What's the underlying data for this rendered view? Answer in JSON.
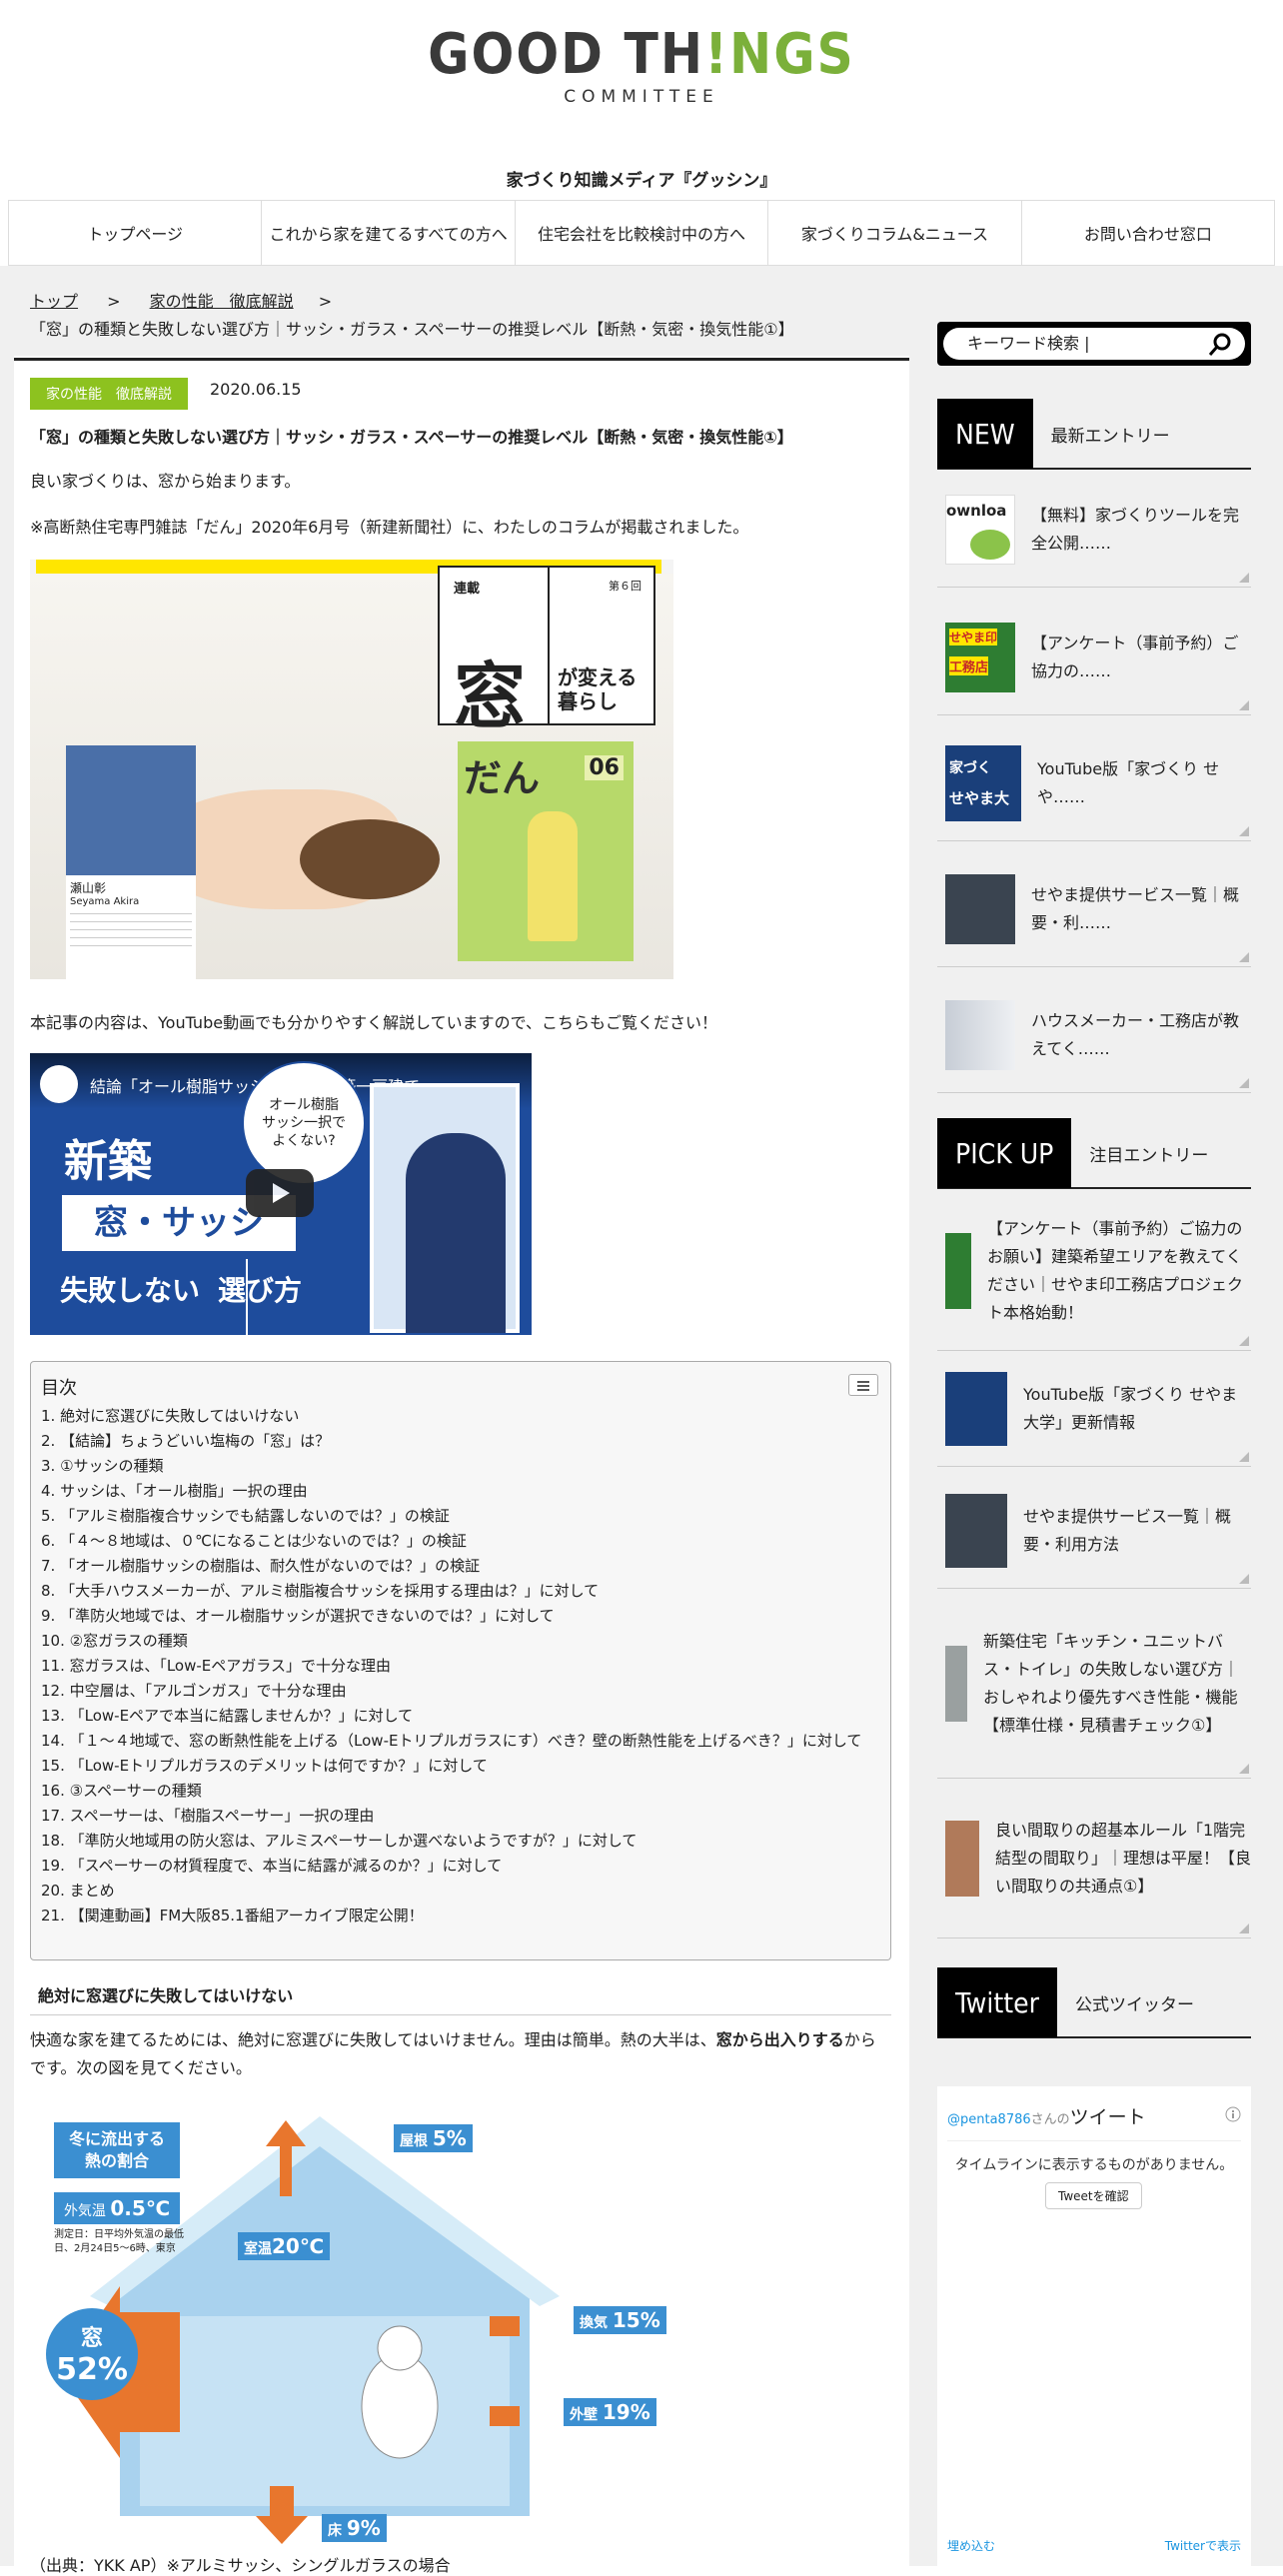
{
  "site": {
    "logo_good": "GOOD TH",
    "logo_excl": "!",
    "logo_things": "NGS",
    "logo_committee": "COMMITTEE",
    "tagline": "家づくり知識メディア『グッシン』"
  },
  "nav": [
    "トップページ",
    "これから家を建てるすべての方へ",
    "住宅会社を比較検討中の方へ",
    "家づくりコラム&ニュース",
    "お問い合わせ窓口"
  ],
  "breadcrumb": {
    "top": "トップ",
    "sep": ">",
    "cat": "家の性能　徹底解説",
    "current": "「窓」の種類と失敗しない選び方｜サッシ・ガラス・スペーサーの推奨レベル【断熱・気密・換気性能①】"
  },
  "article": {
    "category": "家の性能　徹底解説",
    "date": "2020.06.15",
    "title": "「窓」の種類と失敗しない選び方｜サッシ・ガラス・スペーサーの推奨レベル【断熱・気密・換気性能①】",
    "p1": "良い家づくりは、窓から始まります。",
    "p2": "※高断熱住宅専門雑誌「だん」2020年6月号（新建新聞社）に、わたしのコラムが掲載されました。",
    "hero": {
      "rensai": "連載",
      "issue": "第６回",
      "big": "窓",
      "sub": "が変える\n暮らし",
      "dan": "だん",
      "name": "瀬山彰",
      "name_en": "Seyama Akira",
      "mag_no": "06"
    },
    "p3": "本記事の内容は、YouTube動画でも分かりやすく解説していますので、こちらもご覧ください！",
    "video": {
      "title": "結論「オール樹脂サッシ」1択／新築一戸建て…",
      "bubble": "オール樹脂\nサッシ一択で\nよくない?",
      "l1": "新築",
      "l2": "窓・サッシ",
      "l3": "失敗しない",
      "l4": "選び方"
    },
    "toc_title": "目次",
    "toc": [
      "1. 絶対に窓選びに失敗してはいけない",
      "2. 【結論】ちょうどいい塩梅の「窓」は？",
      "3. ①サッシの種類",
      "4. サッシは、「オール樹脂」一択の理由",
      "5. 「アルミ樹脂複合サッシでも結露しないのでは？」の検証",
      "6. 「４～８地域は、０℃になることは少ないのでは？」の検証",
      "7. 「オール樹脂サッシの樹脂は、耐久性がないのでは？」の検証",
      "8. 「大手ハウスメーカーが、アルミ樹脂複合サッシを採用する理由は？」に対して",
      "9. 「準防火地域では、オール樹脂サッシが選択できないのでは？」に対して",
      "10. ②窓ガラスの種類",
      "11. 窓ガラスは、「Low-Eペアガラス」で十分な理由",
      "12. 中空層は、「アルゴンガス」で十分な理由",
      "13. 「Low-Eペアで本当に結露しませんか？」に対して",
      "14. 「１～４地域で、窓の断熱性能を上げる（Low-Eトリプルガラスにす）べき？壁の断熱性能を上げるべき？」に対して",
      "15. 「Low-Eトリプルガラスのデメリットは何ですか？」に対して",
      "16. ③スペーサーの種類",
      "17. スペーサーは、「樹脂スペーサー」一択の理由",
      "18. 「準防火地域用の防火窓は、アルミスペーサーしか選べないようですが？」に対して",
      "19. 「スペーサーの材質程度で、本当に結露が減るのか？」に対して",
      "20. まとめ",
      "21. 【関連動画】FM大阪85.1番組アーカイブ限定公開！"
    ],
    "h2": "絶対に窓選びに失敗してはいけない",
    "p4a": "快適な家を建てるためには、絶対に窓選びに失敗してはいけません。理由は簡単。熱の大半は、",
    "p4b": "窓から出入りする",
    "p4c": "からです。次の図を見てください。",
    "heat": {
      "t1": "冬に流出する",
      "t2": "熱の割合",
      "out_label": "外気温",
      "out_temp": "0.5℃",
      "note": "測定日：日平均外気温の最低日、2月24日5～6時、東京",
      "room": "室温",
      "room_temp": "20℃",
      "roof": "屋根",
      "roof_v": "5%",
      "window": "窓",
      "window_v": "52%",
      "vent": "換気",
      "vent_v": "15%",
      "wall": "外壁",
      "wall_v": "19%",
      "floor": "床",
      "floor_v": "9%"
    },
    "caption": "（出典：YKK AP）※アルミサッシ、シングルガラスの場合"
  },
  "sidebar": {
    "search_placeholder": "キーワード検索 |",
    "new_block": "NEW",
    "new_label": "最新エントリー",
    "new_items": [
      "【無料】家づくりツールを完全公開……",
      "【アンケート（事前予約）ご協力の……",
      "YouTube版「家づくり せや……",
      "せやま提供サービス一覧｜概要・利……",
      "ハウスメーカー・工務店が教えてく……"
    ],
    "pick_block": "PICK UP",
    "pick_label": "注目エントリー",
    "pick_items": [
      "【アンケート（事前予約）ご協力のお願い】建築希望エリアを教えてください｜せやま印工務店プロジェクト本格始動！",
      "YouTube版「家づくり せやま大学」更新情報",
      "せやま提供サービス一覧｜概要・利用方法",
      "新築住宅「キッチン・ユニットバス・トイレ」の失敗しない選び方｜おしゃれより優先すべき性能・機能【標準仕様・見積書チェック①】",
      "良い間取りの超基本ルール「1階完結型の間取り」｜理想は平屋！【良い間取りの共通点①】"
    ],
    "tw_block": "Twitter",
    "tw_label": "公式ツイッター",
    "tw_user": "@penta8786",
    "tw_san": "さんの",
    "tw_tweets": "ツイート",
    "tw_empty": "タイムラインに表示するものがありません。",
    "tw_button": "Tweetを確認",
    "tw_embed": "埋め込む",
    "tw_view": "Twitterで表示",
    "thumb_download": "ownloa",
    "thumb_seyama": "せやま印",
    "thumb_koumuten": "工務店",
    "thumb_ie": "家づく",
    "thumb_seyamadai": "せやま大"
  }
}
